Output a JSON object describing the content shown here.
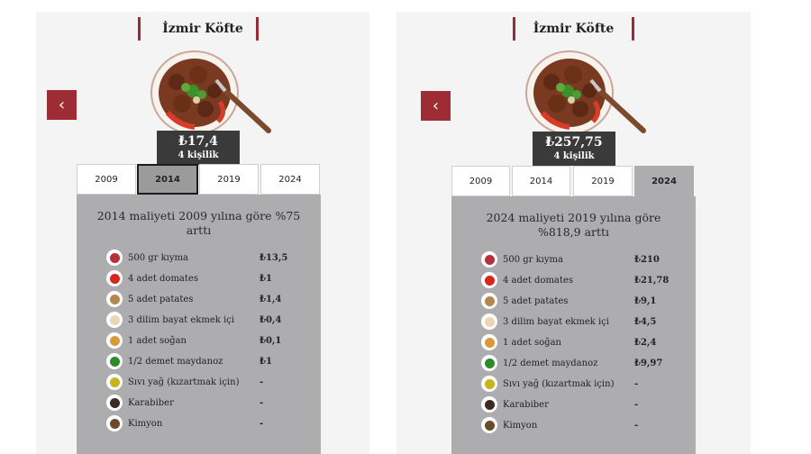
{
  "cards": [
    {
      "title": "İzmir Köfte",
      "price": "₺17,4",
      "people": "4 kişilik",
      "tabs": [
        "2009",
        "2014",
        "2019",
        "2024"
      ],
      "active_tab": "2014",
      "headline": "2014 maliyeti 2009 yılına göre %75 arttı",
      "ingredients": [
        {
          "name": "500 gr kıyma",
          "cost": "₺13,5",
          "icon": "minced-meat-icon",
          "color": "#b5303a"
        },
        {
          "name": "4 adet domates",
          "cost": "₺1",
          "icon": "tomato-icon",
          "color": "#d8261f"
        },
        {
          "name": "5 adet patates",
          "cost": "₺1,4",
          "icon": "potato-icon",
          "color": "#b3884e"
        },
        {
          "name": "3 dilim bayat ekmek içi",
          "cost": "₺0,4",
          "icon": "bread-icon",
          "color": "#e9d7b4"
        },
        {
          "name": "1 adet soğan",
          "cost": "₺0,1",
          "icon": "onion-icon",
          "color": "#d69a3a"
        },
        {
          "name": "1/2 demet maydanoz",
          "cost": "₺1",
          "icon": "parsley-icon",
          "color": "#2f8a2b"
        },
        {
          "name": "Sıvı yağ (kızartmak için)",
          "cost": "-",
          "icon": "oil-icon",
          "color": "#c9b21f"
        },
        {
          "name": "Karabiber",
          "cost": "-",
          "icon": "black-pepper-icon",
          "color": "#3c2a22"
        },
        {
          "name": "Kimyon",
          "cost": "-",
          "icon": "cumin-icon",
          "color": "#6a4a2a"
        }
      ]
    },
    {
      "title": "İzmir Köfte",
      "price": "₺257,75",
      "people": "4 kişilik",
      "tabs": [
        "2009",
        "2014",
        "2019",
        "2024"
      ],
      "active_tab": "2024",
      "headline": "2024 maliyeti 2019 yılına göre %818,9 arttı",
      "ingredients": [
        {
          "name": "500 gr kıyma",
          "cost": "₺210",
          "icon": "minced-meat-icon",
          "color": "#b5303a"
        },
        {
          "name": "4 adet domates",
          "cost": "₺21,78",
          "icon": "tomato-icon",
          "color": "#d8261f"
        },
        {
          "name": "5 adet patates",
          "cost": "₺9,1",
          "icon": "potato-icon",
          "color": "#b3884e"
        },
        {
          "name": "3 dilim bayat ekmek içi",
          "cost": "₺4,5",
          "icon": "bread-icon",
          "color": "#e9d7b4"
        },
        {
          "name": "1 adet soğan",
          "cost": "₺2,4",
          "icon": "onion-icon",
          "color": "#d69a3a"
        },
        {
          "name": "1/2 demet maydanoz",
          "cost": "₺9,97",
          "icon": "parsley-icon",
          "color": "#2f8a2b"
        },
        {
          "name": "Sıvı yağ (kızartmak için)",
          "cost": "-",
          "icon": "oil-icon",
          "color": "#c9b21f"
        },
        {
          "name": "Karabiber",
          "cost": "-",
          "icon": "black-pepper-icon",
          "color": "#3c2a22"
        },
        {
          "name": "Kimyon",
          "cost": "-",
          "icon": "cumin-icon",
          "color": "#6a4a2a"
        }
      ]
    }
  ],
  "colors": {
    "accent": "#9d2c35",
    "panel": "#adadaf",
    "price_box": "#3a3a3a"
  }
}
